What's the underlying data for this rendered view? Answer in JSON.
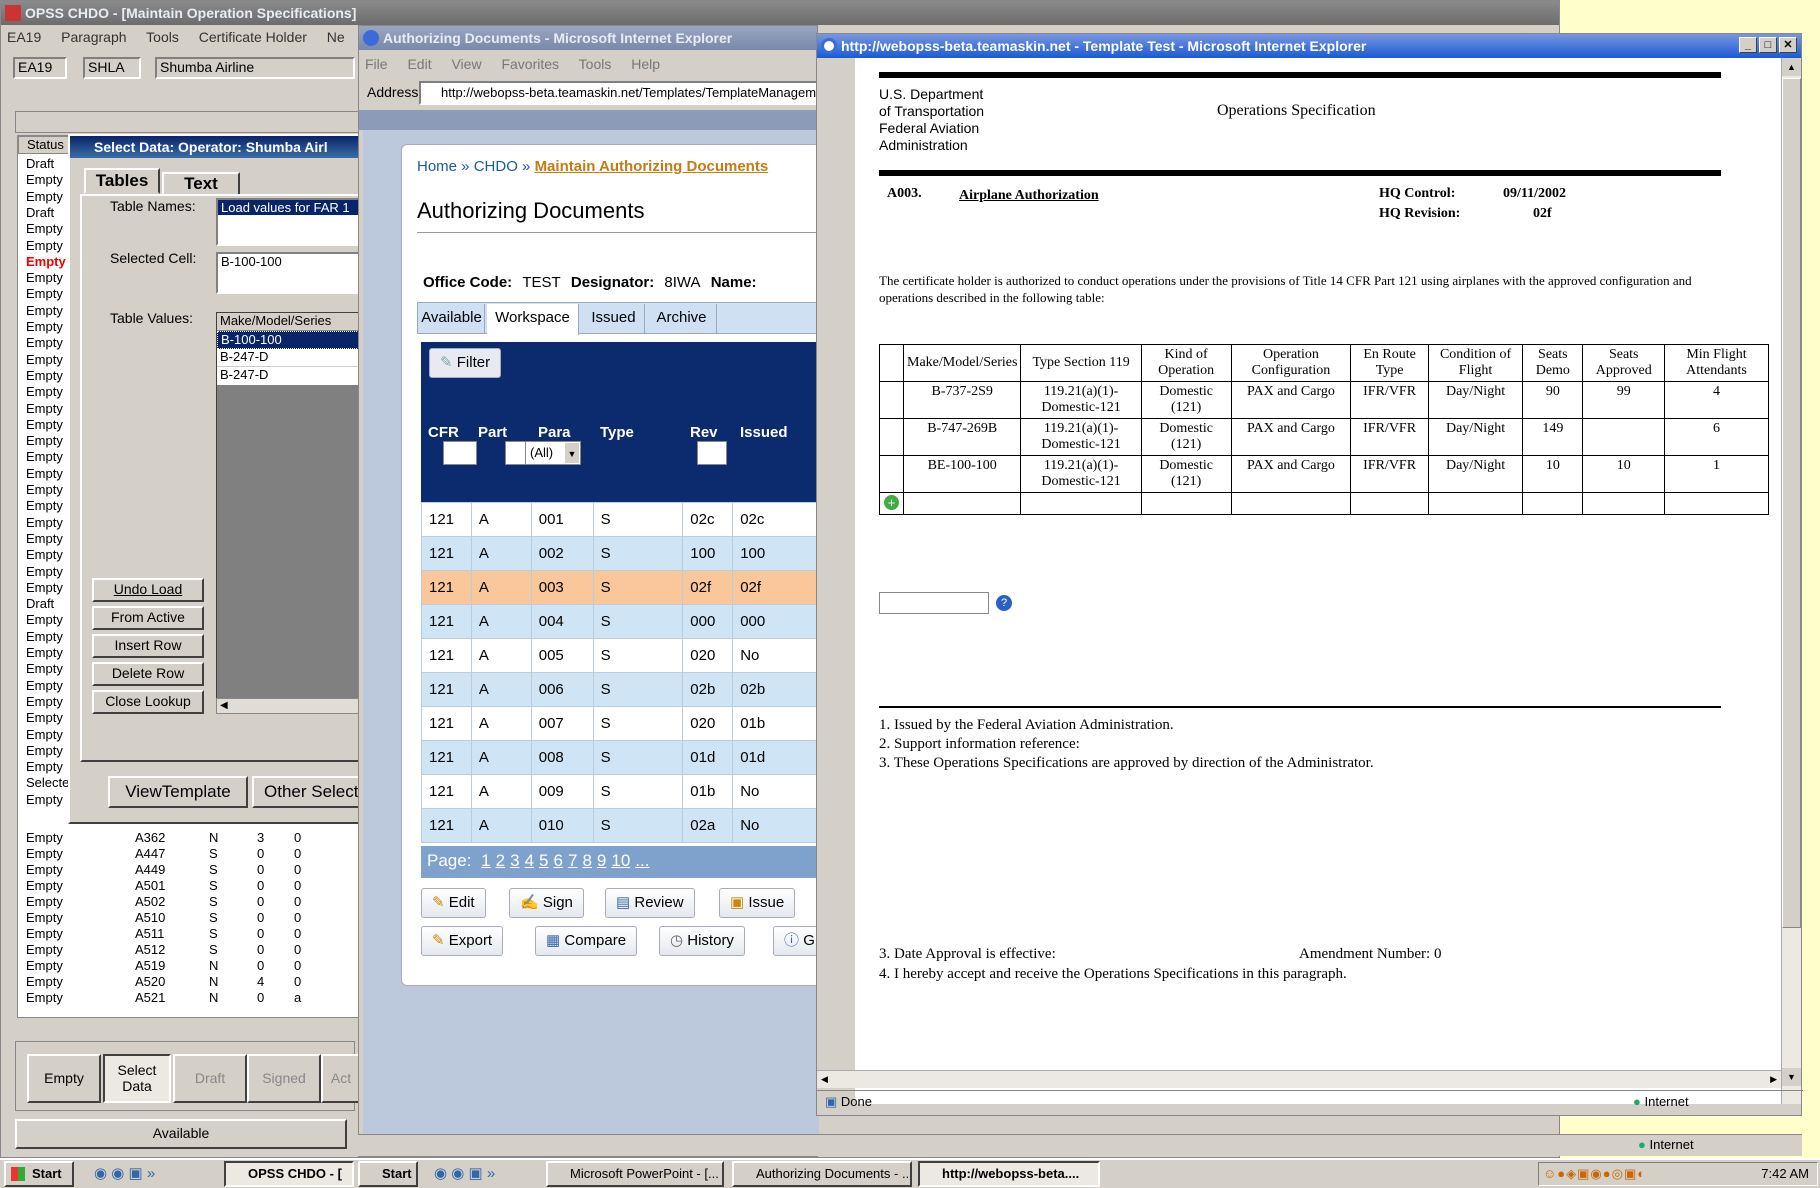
{
  "win1": {
    "title": "OPSS CHDO - [Maintain Operation Specifications]",
    "menus": [
      "EA19",
      "Paragraph",
      "Tools",
      "Certificate Holder",
      "Ne"
    ],
    "fields": [
      "EA19",
      "SHLA",
      "Shumba Airline"
    ],
    "status_header": "Status",
    "status_list": [
      "Draft",
      "Empty",
      "Empty",
      "Draft",
      "Empty",
      "Empty",
      "Empty",
      "Empty",
      "Empty",
      "Empty",
      "Empty",
      "Empty",
      "Empty",
      "Empty",
      "Empty",
      "Empty",
      "Empty",
      "Empty",
      "Empty",
      "Empty",
      "Empty",
      "Empty",
      "Empty",
      "Empty",
      "Empty",
      "Empty",
      "Empty",
      "Draft",
      "Empty",
      "Empty",
      "Empty",
      "Empty",
      "Empty",
      "Empty",
      "Empty",
      "Empty",
      "Empty",
      "Empty",
      "Selecte",
      "Empty"
    ],
    "bottom_rows": [
      [
        "Empty",
        "A362",
        "N",
        "3",
        "0"
      ],
      [
        "Empty",
        "A447",
        "S",
        "0",
        "0"
      ],
      [
        "Empty",
        "A449",
        "S",
        "0",
        "0"
      ],
      [
        "Empty",
        "A501",
        "S",
        "0",
        "0"
      ],
      [
        "Empty",
        "A502",
        "S",
        "0",
        "0"
      ],
      [
        "Empty",
        "A510",
        "S",
        "0",
        "0"
      ],
      [
        "Empty",
        "A511",
        "S",
        "0",
        "0"
      ],
      [
        "Empty",
        "A512",
        "S",
        "0",
        "0"
      ],
      [
        "Empty",
        "A519",
        "N",
        "0",
        "0"
      ],
      [
        "Empty",
        "A520",
        "N",
        "4",
        "0"
      ],
      [
        "Empty",
        "A521",
        "N",
        "0",
        "a"
      ]
    ],
    "bottom_tabs": [
      "Empty",
      "Select Data",
      "Draft",
      "Signed",
      "Act"
    ],
    "available": "Available"
  },
  "dialog": {
    "title": "Select Data:  Operator: Shumba Airl",
    "tabs": [
      "Tables",
      "Text"
    ],
    "table_names_label": "Table Names:",
    "table_names_value": "Load values for FAR 1",
    "selected_cell_label": "Selected Cell:",
    "selected_cell_value": "B-100-100",
    "table_values_label": "Table Values:",
    "col_header": "Make/Model/Series",
    "values": [
      "B-100-100",
      "B-247-D",
      "B-247-D"
    ],
    "buttons": [
      "Undo Load",
      "From Active",
      "Insert Row",
      "Delete Row",
      "Close Lookup"
    ],
    "view_template": "ViewTemplate",
    "other_select": "Other Select"
  },
  "win2": {
    "title": "Authorizing Documents - Microsoft Internet Explorer",
    "menus": [
      "File",
      "Edit",
      "View",
      "Favorites",
      "Tools",
      "Help"
    ],
    "address_label": "Address",
    "address": "http://webopss-beta.teamaskin.net/Templates/TemplateManageme",
    "breadcrumb": [
      "Home",
      "CHDO",
      "Maintain Authorizing Documents"
    ],
    "heading": "Authorizing Documents",
    "office_label": "Office Code:",
    "office_value": "TEST",
    "designator_label": "Designator:",
    "designator_value": "8IWA",
    "name_label": "Name:",
    "tabs": [
      "Available",
      "Workspace",
      "Issued",
      "Archive"
    ],
    "filter": "Filter",
    "columns": [
      "CFR",
      "Part",
      "Para",
      "Type",
      "Rev",
      "Issued"
    ],
    "type_filter": "(All)",
    "rows": [
      [
        "121",
        "A",
        "001",
        "S",
        "02c",
        "02c"
      ],
      [
        "121",
        "A",
        "002",
        "S",
        "100",
        "100"
      ],
      [
        "121",
        "A",
        "003",
        "S",
        "02f",
        "02f"
      ],
      [
        "121",
        "A",
        "004",
        "S",
        "000",
        "000"
      ],
      [
        "121",
        "A",
        "005",
        "S",
        "020",
        "No"
      ],
      [
        "121",
        "A",
        "006",
        "S",
        "02b",
        "02b"
      ],
      [
        "121",
        "A",
        "007",
        "S",
        "020",
        "01b"
      ],
      [
        "121",
        "A",
        "008",
        "S",
        "01d",
        "01d"
      ],
      [
        "121",
        "A",
        "009",
        "S",
        "01b",
        "No"
      ],
      [
        "121",
        "A",
        "010",
        "S",
        "02a",
        "No"
      ]
    ],
    "page_label": "Page:",
    "pages": [
      "1",
      "2",
      "3",
      "4",
      "5",
      "6",
      "7",
      "8",
      "9",
      "10",
      "..."
    ],
    "actions": [
      "Edit",
      "Sign",
      "Review",
      "Issue",
      "Export",
      "Compare",
      "History",
      "G"
    ]
  },
  "win3": {
    "title": "http://webopss-beta.teamaskin.net - Template Test - Microsoft Internet Explorer",
    "dept": [
      "U.S. Department",
      "of Transportation",
      "Federal Aviation",
      "Administration"
    ],
    "doc_title": "Operations Specification",
    "para_id": "A003.",
    "para_title": "Airplane Authorization",
    "hq_control_label": "HQ Control:",
    "hq_control": "09/11/2002",
    "hq_revision_label": "HQ Revision:",
    "hq_revision": "02f",
    "intro": "The certificate holder is authorized to conduct operations under the provisions of Title 14 CFR Part 121 using airplanes with the approved configuration and operations described in the following table:",
    "table_headers": [
      "Make/Model/Series",
      "Type Section 119",
      "Kind of Operation",
      "Operation Configuration",
      "En Route Type",
      "Condition of Flight",
      "Seats Demo",
      "Seats Approved",
      "Min Flight Attendants"
    ],
    "table_rows": [
      [
        "B-737-2S9",
        "119.21(a)(1)-Domestic-121",
        "Domestic (121)",
        "PAX and Cargo",
        "IFR/VFR",
        "Day/Night",
        "90",
        "99",
        "4"
      ],
      [
        "B-747-269B",
        "119.21(a)(1)-Domestic-121",
        "Domestic (121)",
        "PAX and Cargo",
        "IFR/VFR",
        "Day/Night",
        "149",
        "",
        "6"
      ],
      [
        "BE-100-100",
        "119.21(a)(1)-Domestic-121",
        "Domestic (121)",
        "PAX and Cargo",
        "IFR/VFR",
        "Day/Night",
        "10",
        "10",
        "1"
      ]
    ],
    "footer": [
      "1. Issued by the Federal Aviation Administration.",
      "2. Support information reference:",
      "3. These Operations Specifications are approved by direction of the Administrator."
    ],
    "date_line": "3. Date Approval is effective:",
    "amendment": "Amendment Number: 0",
    "accept": "4.  I hereby accept and receive the Operations Specifications in this paragraph.",
    "status_done": "Done",
    "zone": "Internet"
  },
  "ie2_zone": "Internet",
  "taskbar": {
    "start": "Start",
    "left_task": "OPSS CHDO - [",
    "start2": "Start",
    "tasks": [
      "Microsoft PowerPoint - [...",
      "Authorizing Documents - ...",
      "http://webopss-beta...."
    ],
    "clock": "7:42 AM"
  },
  "colors": {
    "title_active": "#1a5ad6",
    "grid_header": "#0c2a6e",
    "row_alt": "#cfe4f4",
    "row_hl": "#f9c79a",
    "link": "#c87a10",
    "desktop": "#ffffcc"
  }
}
